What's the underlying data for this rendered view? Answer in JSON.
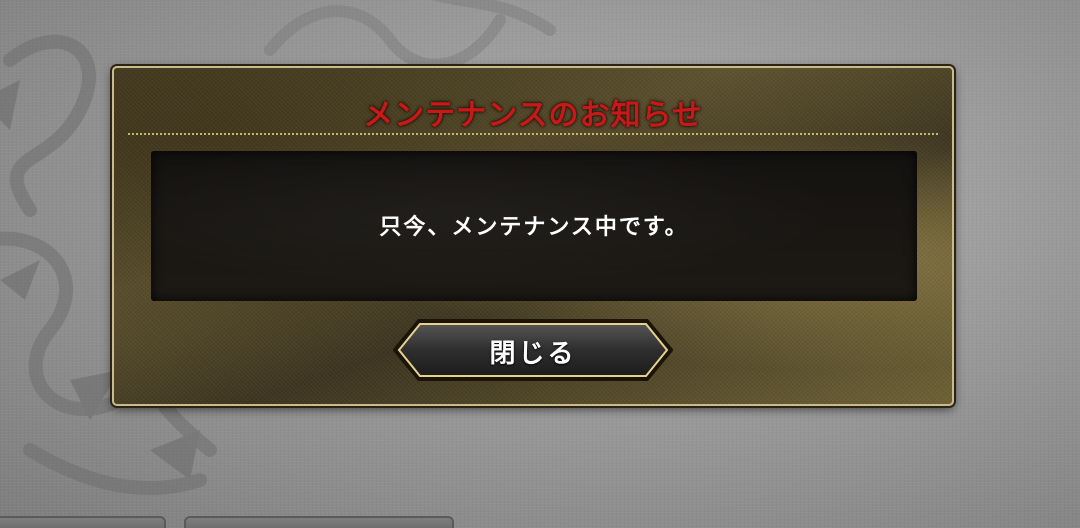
{
  "dialog": {
    "title": "メンテナンスのお知らせ",
    "message": "只今、メンテナンス中です。",
    "close_button_label": "閉じる"
  },
  "colors": {
    "title_text": "#c81818",
    "dialog_border": "#c9bb8a",
    "panel_background": "#17140f",
    "button_outline": "#e6d08a"
  },
  "icons": {
    "background_ornament": "ornament-icon"
  }
}
